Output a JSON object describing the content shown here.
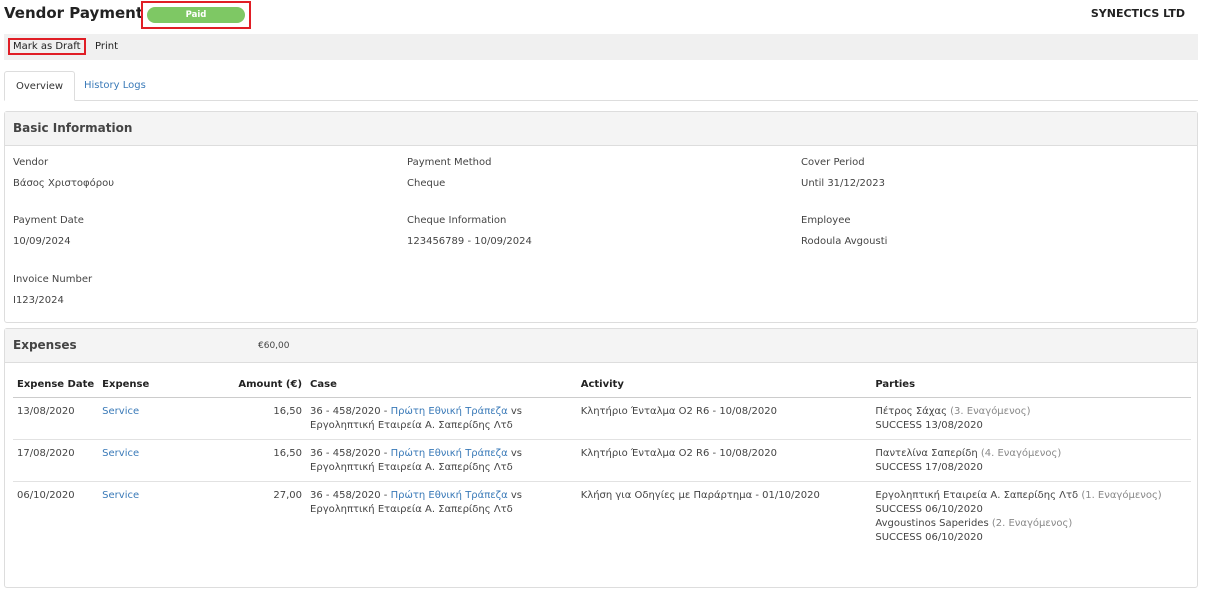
{
  "header": {
    "title": "Vendor Payment",
    "status": "Paid",
    "company": "SYNECTICS LTD"
  },
  "toolbar": {
    "mark_draft": "Mark as Draft",
    "print": "Print"
  },
  "tabs": [
    {
      "label": "Overview",
      "active": true
    },
    {
      "label": "History Logs",
      "active": false
    }
  ],
  "basic": {
    "title": "Basic Information",
    "fields": {
      "vendor": {
        "label": "Vendor",
        "value": "Βάσος Χριστοφόρου"
      },
      "payment_method": {
        "label": "Payment Method",
        "value": "Cheque"
      },
      "cover_period": {
        "label": "Cover Period",
        "value": "Until 31/12/2023"
      },
      "payment_date": {
        "label": "Payment Date",
        "value": "10/09/2024"
      },
      "cheque_info": {
        "label": "Cheque Information",
        "value": "123456789 - 10/09/2024"
      },
      "employee": {
        "label": "Employee",
        "value": "Rodoula Avgousti"
      },
      "invoice_number": {
        "label": "Invoice Number",
        "value": "I123/2024"
      }
    }
  },
  "expenses": {
    "title": "Expenses",
    "total": "€60,00",
    "columns": {
      "date": "Expense Date",
      "expense": "Expense",
      "amount": "Amount (€)",
      "case": "Case",
      "activity": "Activity",
      "parties": "Parties"
    },
    "rows": [
      {
        "date": "13/08/2020",
        "expense": "Service",
        "amount": "16,50",
        "case_prefix": "36 - 458/2020 - ",
        "case_link": "Πρώτη Εθνική Τράπεζα",
        "case_vs": " vs",
        "case_line2": "Εργοληπτική Εταιρεία Α. Σαπερίδης Λτδ",
        "activity": "Κλητήριο Ένταλμα Ο2 R6 - 10/08/2020",
        "parties": [
          {
            "name": "Πέτρος Σάχας",
            "role": "(3. Εναγόμενος)",
            "status": "SUCCESS 13/08/2020"
          }
        ]
      },
      {
        "date": "17/08/2020",
        "expense": "Service",
        "amount": "16,50",
        "case_prefix": "36 - 458/2020 - ",
        "case_link": "Πρώτη Εθνική Τράπεζα",
        "case_vs": " vs",
        "case_line2": "Εργοληπτική Εταιρεία Α. Σαπερίδης Λτδ",
        "activity": "Κλητήριο Ένταλμα Ο2 R6 - 10/08/2020",
        "parties": [
          {
            "name": "Παντελίνα Σαπερίδη",
            "role": "(4. Εναγόμενος)",
            "status": "SUCCESS 17/08/2020"
          }
        ]
      },
      {
        "date": "06/10/2020",
        "expense": "Service",
        "amount": "27,00",
        "case_prefix": "36 - 458/2020 - ",
        "case_link": "Πρώτη Εθνική Τράπεζα",
        "case_vs": " vs",
        "case_line2": "Εργοληπτική Εταιρεία Α. Σαπερίδης Λτδ",
        "activity": "Κλήση για Οδηγίες με Παράρτημα - 01/10/2020",
        "parties": [
          {
            "name": "Εργοληπτική Εταιρεία Α. Σαπερίδης Λτδ",
            "role": "(1. Εναγόμενος)",
            "status": "SUCCESS 06/10/2020"
          },
          {
            "name": "Avgoustinos Saperides",
            "role": "(2. Εναγόμενος)",
            "status": "SUCCESS 06/10/2020"
          }
        ]
      }
    ]
  },
  "colors": {
    "paid_badge": "#7ec864",
    "highlight_border": "#e01e26",
    "link": "#3a7ab8"
  }
}
